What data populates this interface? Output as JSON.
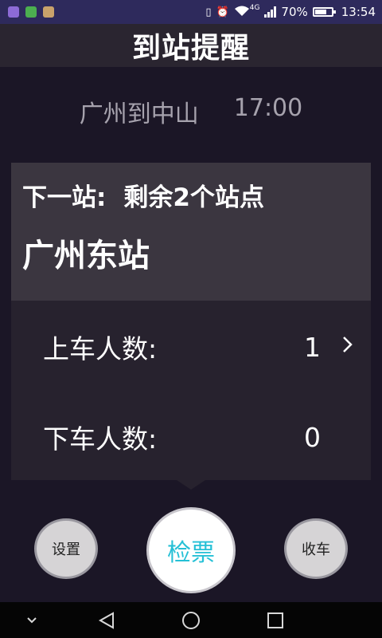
{
  "status_bar": {
    "wifi_label": "4G",
    "battery": "70%",
    "battery_level": 0.7,
    "time": "13:54",
    "apps": [
      {
        "icon": "gallery-icon",
        "color": "#8d6bd6"
      },
      {
        "icon": "wechat-icon",
        "color": "#4caf50"
      },
      {
        "icon": "app-icon",
        "color": "#c9a26b"
      }
    ]
  },
  "header": {
    "title": "到站提醒"
  },
  "route": {
    "name": "广州到中山",
    "time": "17:00"
  },
  "next_station": {
    "label": "下一站:",
    "remaining": "剩余2个站点",
    "name": "广州东站"
  },
  "counts": {
    "boarding_label": "上车人数:",
    "boarding_value": "1",
    "alighting_label": "下车人数:",
    "alighting_value": "0"
  },
  "actions": {
    "settings": "设置",
    "check_ticket": "检票",
    "end_shift": "收车"
  },
  "colors": {
    "accent": "#26c0d6",
    "status_bar": "#2e2a5c",
    "background": "#1b1626"
  }
}
